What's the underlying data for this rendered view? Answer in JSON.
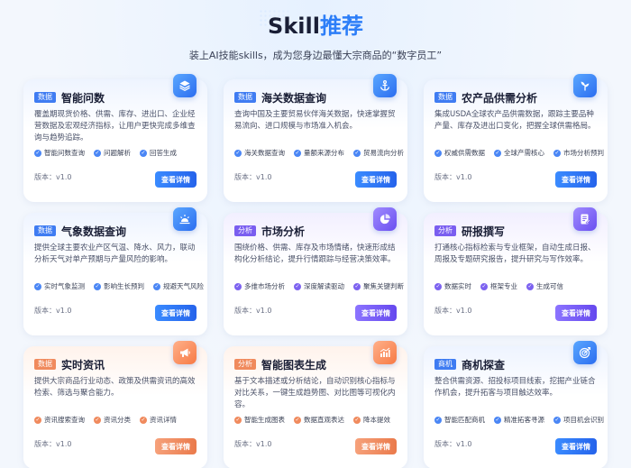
{
  "header": {
    "title_en": "Skill",
    "title_cn": "推荐",
    "subtitle": "装上AI技能skills，成为您身边最懂大宗商品的“数字员工”"
  },
  "cards": [
    {
      "tag": "数据",
      "title": "智能问数",
      "desc": "覆盖期现货价格、供需、库存、进出口、企业经营数据及宏观经济指标，让用户更快完成多维查询与趋势追踪。",
      "features": [
        "智能问数查询",
        "问题解析",
        "回答生成"
      ],
      "version": "版本：v1.0",
      "button": "查看详情",
      "icon": "layers-icon"
    },
    {
      "tag": "数据",
      "title": "海关数据查询",
      "desc": "查询中国及主要贸易伙伴海关数据，快速掌握贸易流向、进口规模与市场准入机会。",
      "features": [
        "海关数据查询",
        "量额来源分布",
        "贸易流向分析"
      ],
      "version": "版本：v1.0",
      "button": "查看详情",
      "icon": "anchor-icon"
    },
    {
      "tag": "数据",
      "title": "农产品供需分析",
      "desc": "集成USDA全球农产品供需数据，跟踪主要品种产量、库存及进出口变化，把握全球供需格局。",
      "features": [
        "权威供需数据",
        "全球产需核心",
        "市场分析预判"
      ],
      "version": "版本：v1.0",
      "button": "查看详情",
      "icon": "sprout-icon"
    },
    {
      "tag": "数据",
      "title": "气象数据查询",
      "desc": "提供全球主要农业产区气温、降水、风力，联动分析天气对单产预期与产量风险的影响。",
      "features": [
        "实时气象监测",
        "影响生长预判",
        "规避天气风险"
      ],
      "version": "版本：v1.0",
      "button": "查看详情",
      "icon": "sunrise-icon"
    },
    {
      "tag": "分析",
      "title": "市场分析",
      "desc": "围绕价格、供需、库存及市场情绪，快速形成结构化分析结论，提升行情跟踪与经营决策效率。",
      "features": [
        "多维市场分析",
        "深度解读驱动",
        "聚焦关键判断"
      ],
      "version": "版本：v1.0",
      "button": "查看详情",
      "icon": "pie-chart-icon"
    },
    {
      "tag": "分析",
      "title": "研报撰写",
      "desc": "打通核心指标检索与专业框架，自动生成日报、周报及专题研究报告，提升研究与写作效率。",
      "features": [
        "数据实时",
        "框架专业",
        "生成可信"
      ],
      "version": "版本：v1.0",
      "button": "查看详情",
      "icon": "document-edit-icon"
    },
    {
      "tag": "数据",
      "title": "实时资讯",
      "desc": "提供大宗商品行业动态、政策及供需资讯的高效检索、筛选与聚合能力。",
      "features": [
        "资讯搜索查询",
        "资讯分类",
        "资讯详情"
      ],
      "version": "版本：v1.0",
      "button": "查看详情",
      "icon": "megaphone-icon"
    },
    {
      "tag": "分析",
      "title": "智能图表生成",
      "desc": "基于文本描述或分析结论，自动识别核心指标与对比关系，一键生成趋势图、对比图等可视化内容。",
      "features": [
        "智能生成图表",
        "数据直观表达",
        "降本提效"
      ],
      "version": "版本：v1.0",
      "button": "查看详情",
      "icon": "bar-chart-icon"
    },
    {
      "tag": "商机",
      "title": "商机探查",
      "desc": "整合供需资源、招投标项目线索，挖掘产业链合作机会，提升拓客与项目触达效率。",
      "features": [
        "智能匹配商机",
        "精准拓客寻源",
        "项目机会识别"
      ],
      "version": "版本：v1.0",
      "button": "查看详情",
      "icon": "target-icon"
    }
  ],
  "colors": {
    "data": "#3f7cf2",
    "analysis": "#7a5ef0",
    "orange": "#f08a5d",
    "title_accent": "#2c7ef8"
  }
}
